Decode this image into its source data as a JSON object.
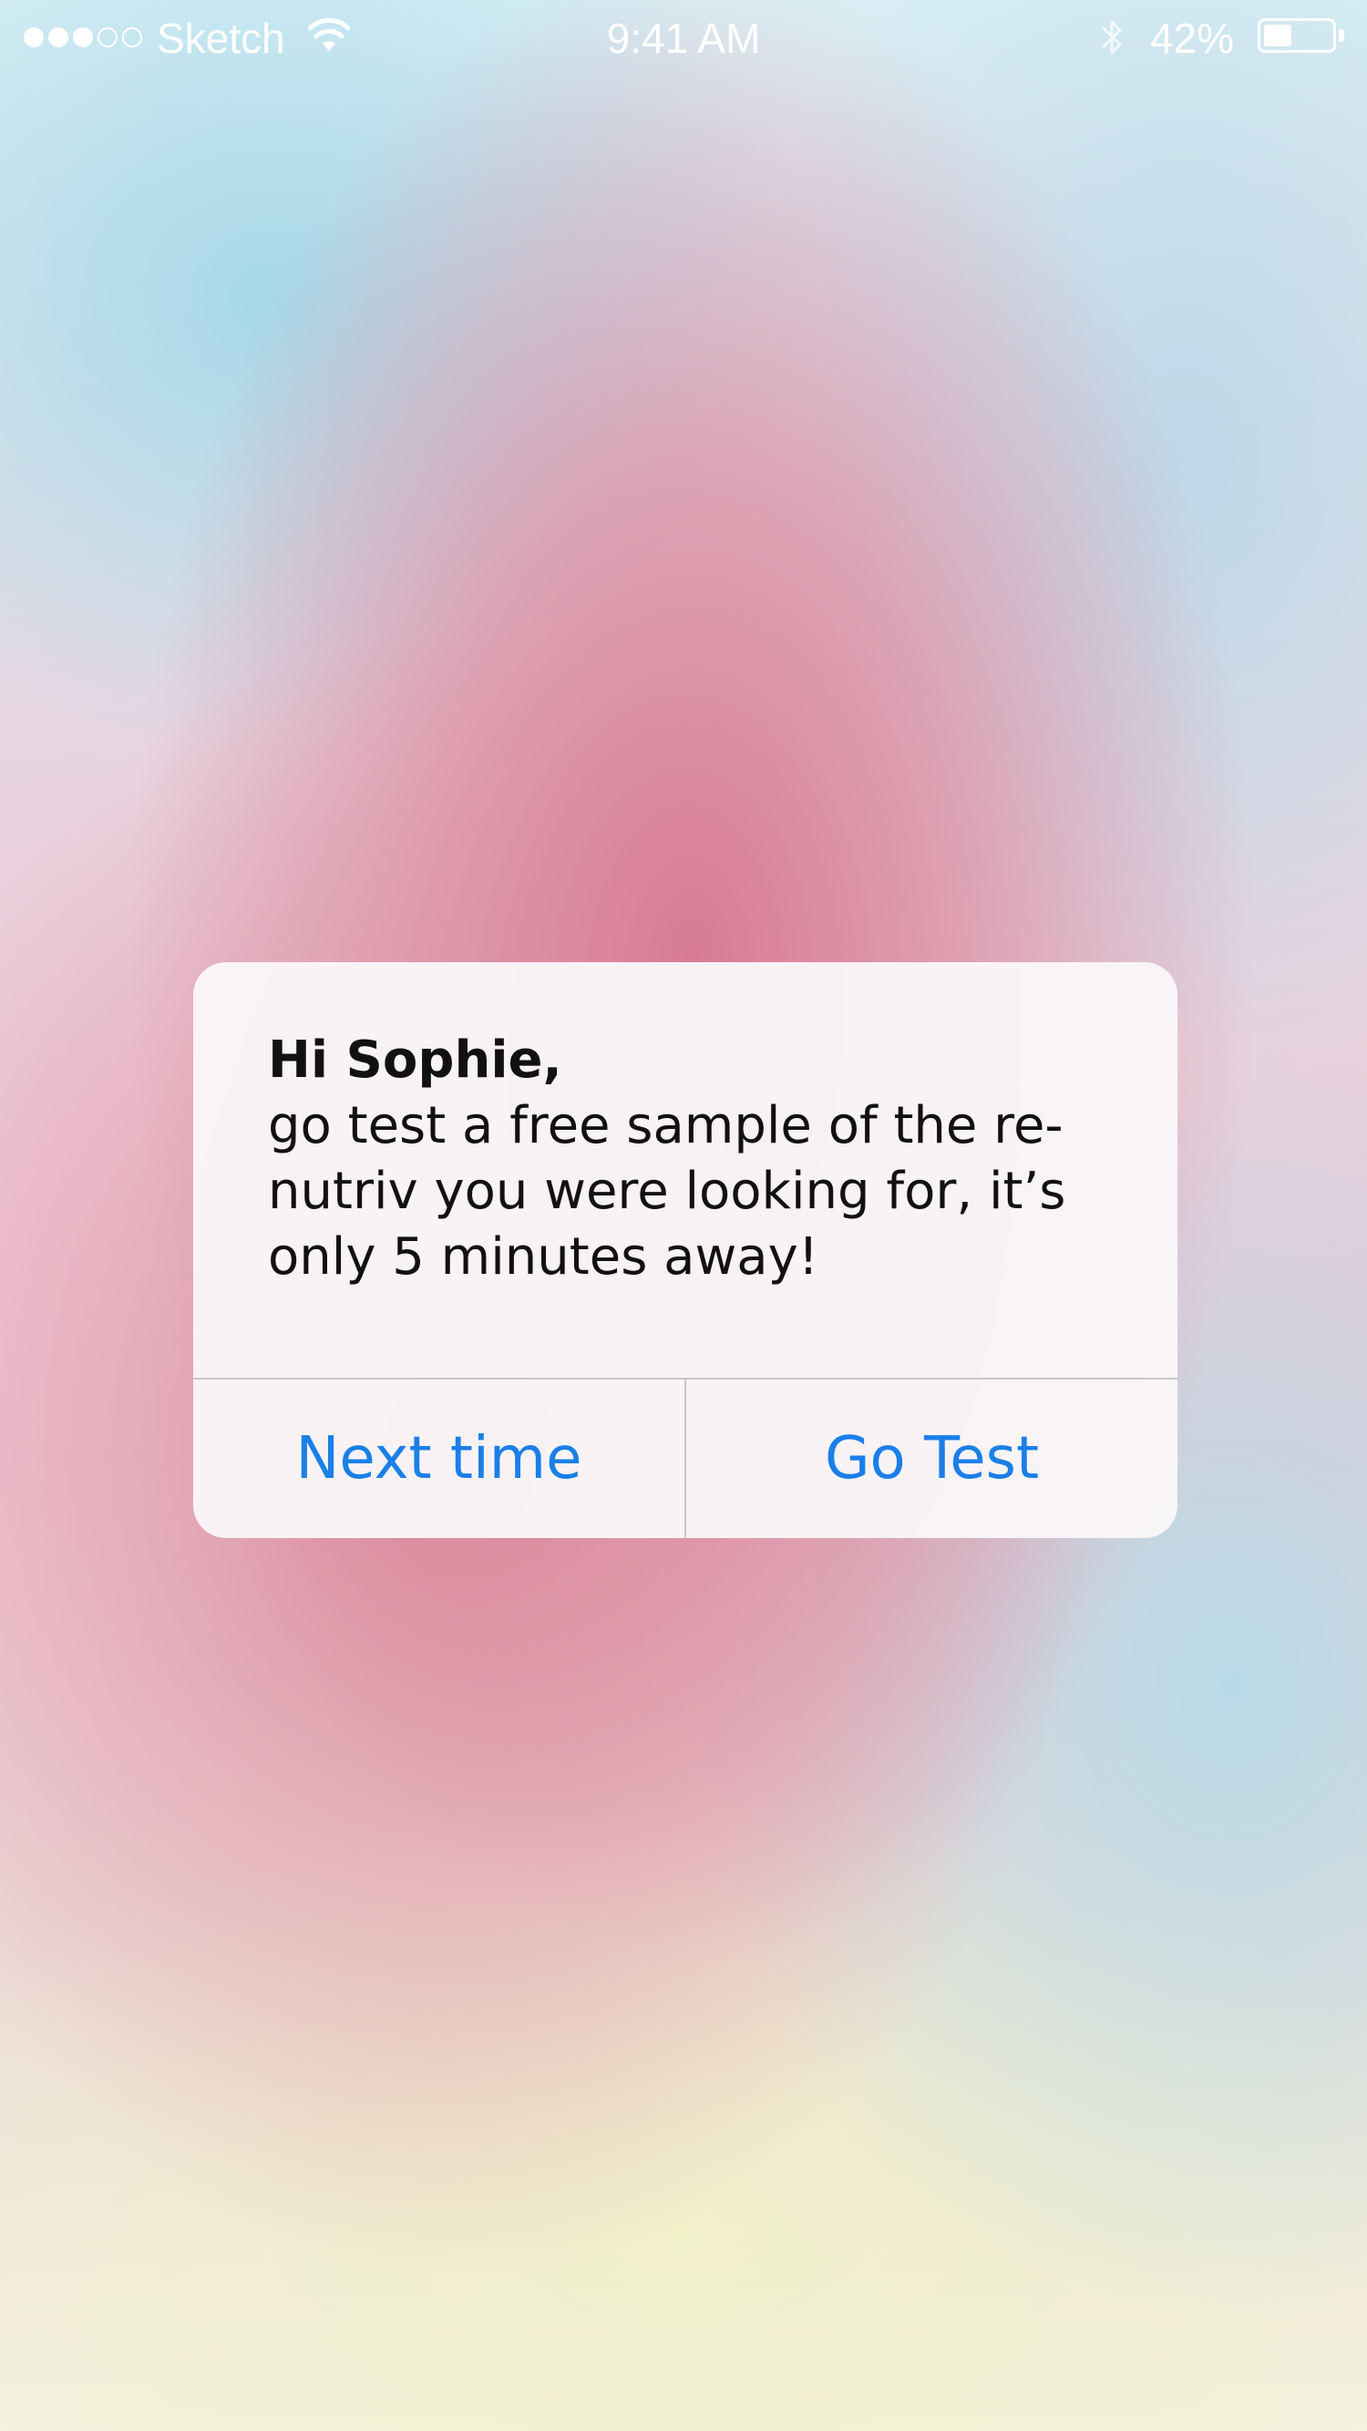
{
  "status_bar": {
    "carrier": "Sketch",
    "time": "9:41 AM",
    "battery_percent": "42%",
    "signal_bars_filled": 3,
    "signal_bars_total": 5,
    "battery_level": 0.42,
    "icons": [
      "wifi-icon",
      "bluetooth-icon",
      "battery-icon"
    ]
  },
  "alert": {
    "title": "Hi Sophie,",
    "message": "go test a free sample of the re-nutriv you were looking for, it’s only 5 minutes away!",
    "buttons": {
      "left_label": "Next time",
      "right_label": "Go Test"
    }
  },
  "colors": {
    "button_text": "#1a7fe8",
    "alert_background": "#faf6f8",
    "status_text": "#ffffff"
  }
}
